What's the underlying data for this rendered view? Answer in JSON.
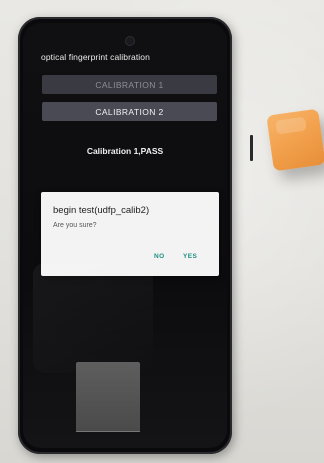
{
  "screen": {
    "app_title": "optical fingerprint calibration",
    "buttons": [
      {
        "label": "CALIBRATION 1",
        "state": "disabled"
      },
      {
        "label": "CALIBRATION 2",
        "state": "enabled"
      }
    ],
    "status": "Calibration 1,PASS",
    "dialog": {
      "title": "begin test(udfp_calib2)",
      "message": "Are you sure?",
      "negative": "NO",
      "positive": "YES"
    }
  },
  "colors": {
    "accent": "#1f8f84",
    "cube": "#f3a24e",
    "screen_bg": "#0c0c0e"
  }
}
